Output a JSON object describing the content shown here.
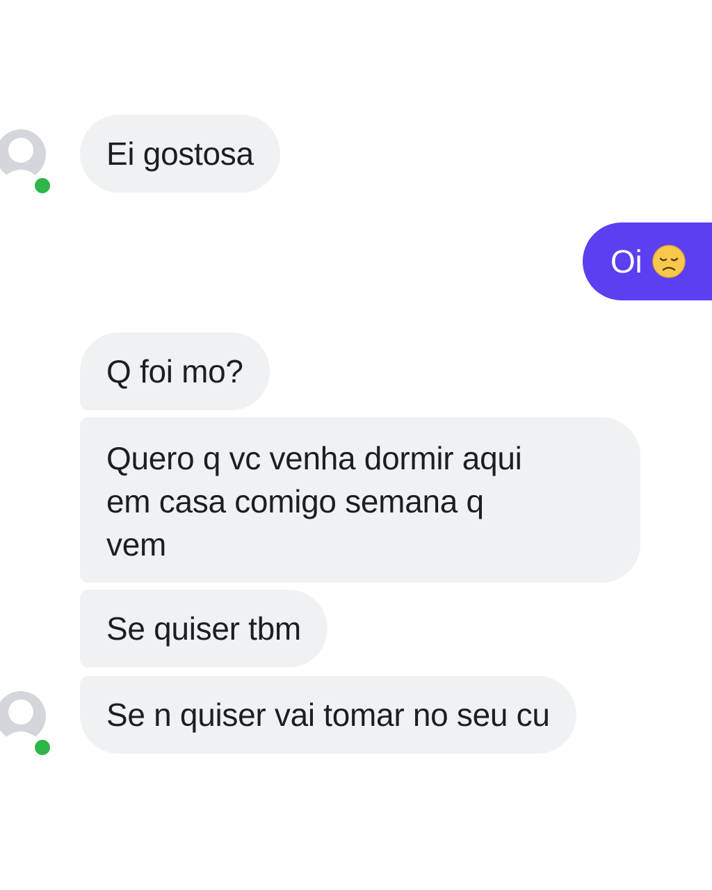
{
  "messages": [
    {
      "direction": "incoming",
      "text": "Ei gostosa"
    },
    {
      "direction": "outgoing",
      "text": "Oi",
      "emoji": "disappointed-face-emoji"
    },
    {
      "direction": "incoming",
      "text": "Q foi mo?"
    },
    {
      "direction": "incoming",
      "lines": [
        "Quero q vc venha dormir aqui",
        "em casa comigo semana q",
        "vem"
      ]
    },
    {
      "direction": "incoming",
      "text": "Se quiser tbm"
    },
    {
      "direction": "incoming",
      "text": "Se n quiser vai tomar no seu cu"
    }
  ],
  "colors": {
    "incoming_bubble": "#f0f1f3",
    "outgoing_bubble": "#5b3ff0",
    "online_status": "#2fb54a",
    "avatar_placeholder": "#c9ccd1"
  },
  "icons": {
    "avatar": "default-avatar-icon",
    "status": "online-status-icon"
  }
}
